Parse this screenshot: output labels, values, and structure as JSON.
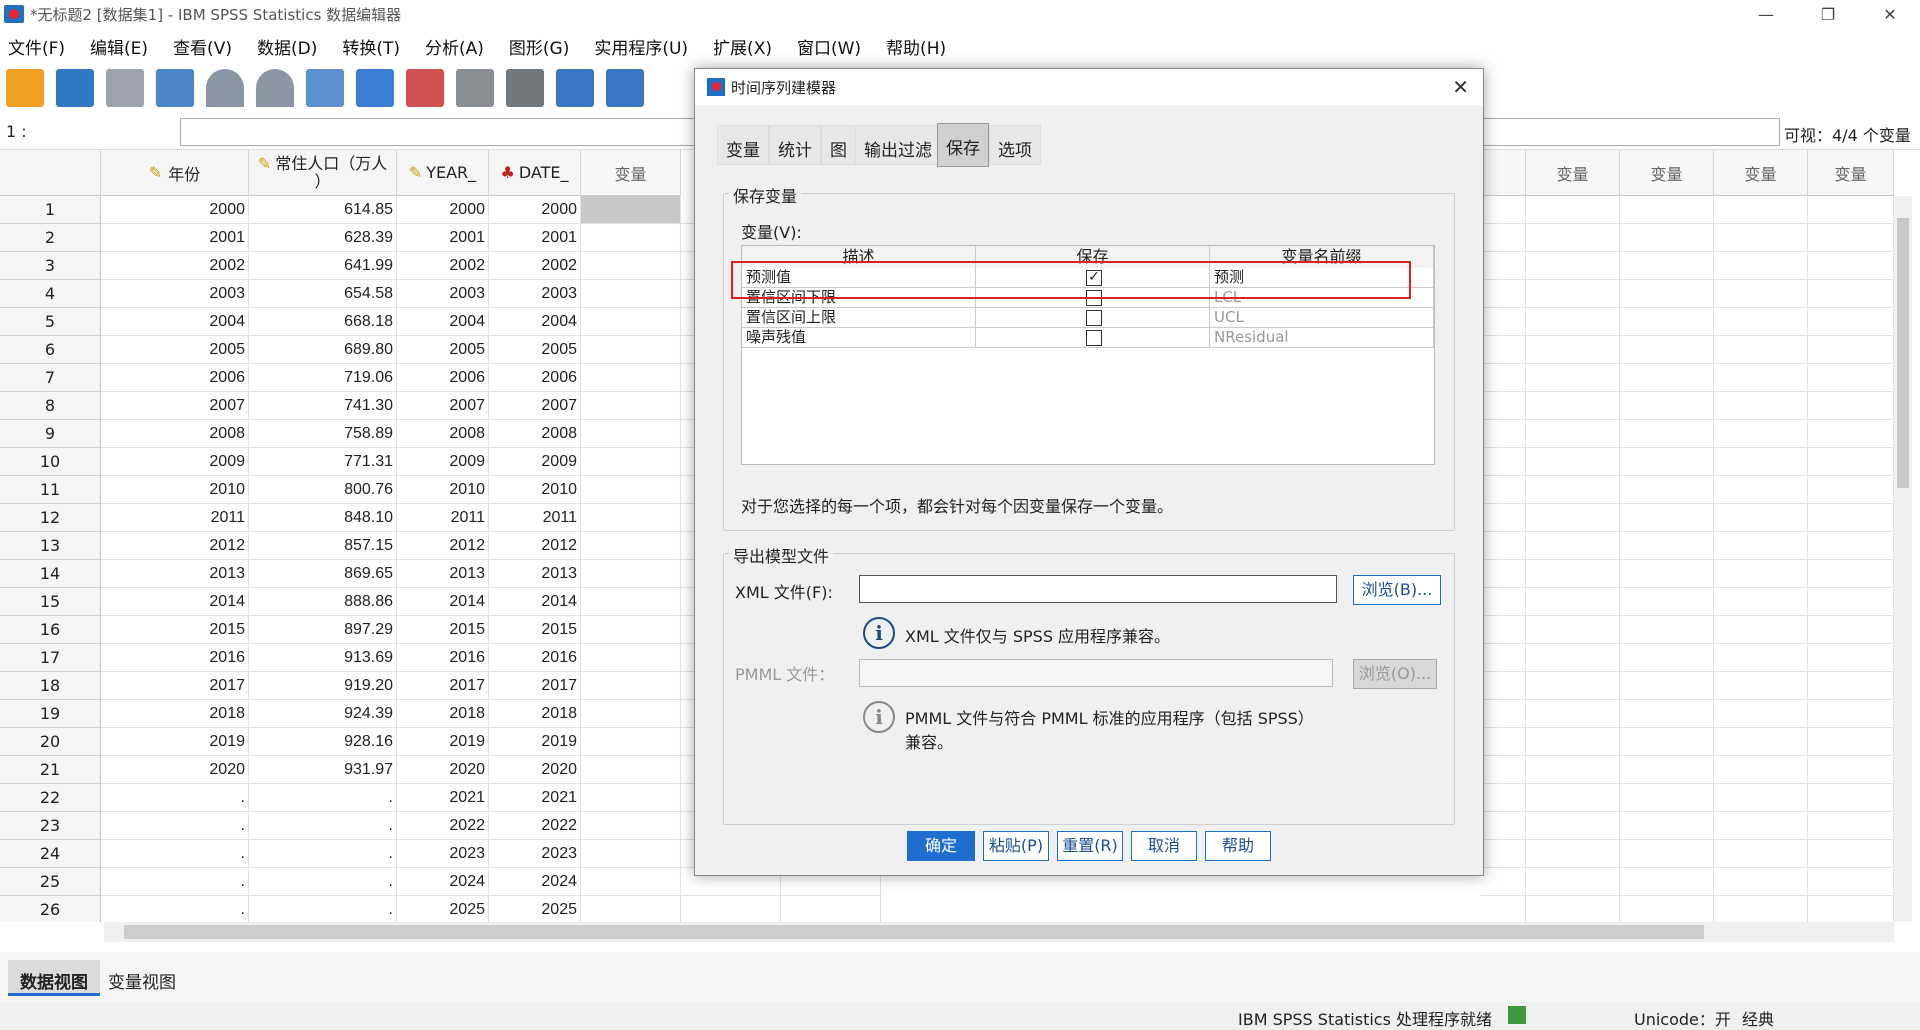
{
  "window": {
    "title": "*无标题2 [数据集1] - IBM SPSS Statistics 数据编辑器",
    "min": "—",
    "max": "❐",
    "close": "✕"
  },
  "menu": [
    "文件(F)",
    "编辑(E)",
    "查看(V)",
    "数据(D)",
    "转换(T)",
    "分析(A)",
    "图形(G)",
    "实用程序(U)",
    "扩展(X)",
    "窗口(W)",
    "帮助(H)"
  ],
  "cellbar": {
    "ref": "1 :",
    "visible": "可视：4/4 个变量"
  },
  "columns": {
    "year": "年份",
    "pop_line1": "常住人口（万人",
    "pop_line2": "）",
    "year_": "YEAR_",
    "date_": "DATE_",
    "var": "变量"
  },
  "rows": [
    [
      "1",
      "2000",
      "614.85",
      "2000",
      "2000"
    ],
    [
      "2",
      "2001",
      "628.39",
      "2001",
      "2001"
    ],
    [
      "3",
      "2002",
      "641.99",
      "2002",
      "2002"
    ],
    [
      "4",
      "2003",
      "654.58",
      "2003",
      "2003"
    ],
    [
      "5",
      "2004",
      "668.18",
      "2004",
      "2004"
    ],
    [
      "6",
      "2005",
      "689.80",
      "2005",
      "2005"
    ],
    [
      "7",
      "2006",
      "719.06",
      "2006",
      "2006"
    ],
    [
      "8",
      "2007",
      "741.30",
      "2007",
      "2007"
    ],
    [
      "9",
      "2008",
      "758.89",
      "2008",
      "2008"
    ],
    [
      "10",
      "2009",
      "771.31",
      "2009",
      "2009"
    ],
    [
      "11",
      "2010",
      "800.76",
      "2010",
      "2010"
    ],
    [
      "12",
      "2011",
      "848.10",
      "2011",
      "2011"
    ],
    [
      "13",
      "2012",
      "857.15",
      "2012",
      "2012"
    ],
    [
      "14",
      "2013",
      "869.65",
      "2013",
      "2013"
    ],
    [
      "15",
      "2014",
      "888.86",
      "2014",
      "2014"
    ],
    [
      "16",
      "2015",
      "897.29",
      "2015",
      "2015"
    ],
    [
      "17",
      "2016",
      "913.69",
      "2016",
      "2016"
    ],
    [
      "18",
      "2017",
      "919.20",
      "2017",
      "2017"
    ],
    [
      "19",
      "2018",
      "924.39",
      "2018",
      "2018"
    ],
    [
      "20",
      "2019",
      "928.16",
      "2019",
      "2019"
    ],
    [
      "21",
      "2020",
      "931.97",
      "2020",
      "2020"
    ],
    [
      "22",
      ".",
      ".",
      "2021",
      "2021"
    ],
    [
      "23",
      ".",
      ".",
      "2022",
      "2022"
    ],
    [
      "24",
      ".",
      ".",
      "2023",
      "2023"
    ],
    [
      "25",
      ".",
      ".",
      "2024",
      "2024"
    ],
    [
      "26",
      ".",
      ".",
      "2025",
      "2025"
    ],
    [
      "27",
      "",
      "",
      "",
      ""
    ]
  ],
  "bottom_tabs": {
    "data_view": "数据视图",
    "var_view": "变量视图"
  },
  "status": {
    "ready": "IBM SPSS Statistics 处理程序就绪",
    "unicode": "Unicode：开",
    "mode": "经典"
  },
  "dialog": {
    "title": "时间序列建模器",
    "tabs": [
      "变量",
      "统计",
      "图",
      "输出过滤",
      "保存",
      "选项"
    ],
    "active_tab": "保存",
    "save_group": "保存变量",
    "vars_label": "变量(V):",
    "table_headers": {
      "desc": "描述",
      "save": "保存",
      "prefix": "变量名前缀"
    },
    "table_rows": [
      {
        "desc": "预测值",
        "checked": true,
        "prefix": "预测"
      },
      {
        "desc": "置信区间下限",
        "checked": false,
        "prefix": "LCL"
      },
      {
        "desc": "置信区间上限",
        "checked": false,
        "prefix": "UCL"
      },
      {
        "desc": "噪声残值",
        "checked": false,
        "prefix": "NResidual"
      }
    ],
    "note": "对于您选择的每一个项，都会针对每个因变量保存一个变量。",
    "export_group": "导出模型文件",
    "xml_label": "XML 文件(F):",
    "xml_value": "",
    "browse1": "浏览(B)...",
    "xml_info": "XML 文件仅与 SPSS 应用程序兼容。",
    "pmml_label": "PMML 文件：",
    "pmml_value": "",
    "browse2": "浏览(O)...",
    "pmml_info_line1": "PMML 文件与符合 PMML 标准的应用程序（包括 SPSS）",
    "pmml_info_line2": "兼容。",
    "buttons": {
      "ok": "确定",
      "paste": "粘贴(P)",
      "reset": "重置(R)",
      "cancel": "取消",
      "help": "帮助"
    }
  },
  "colors": {
    "accent": "#1e6ecf",
    "highlight": "#e02020"
  }
}
